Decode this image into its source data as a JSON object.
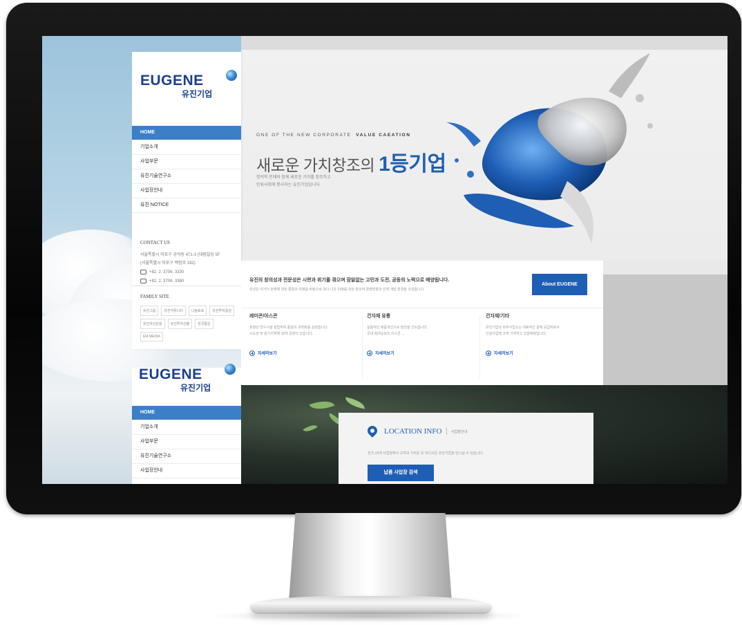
{
  "sidebar": {
    "logo_en": "EUGENE",
    "logo_ko": "유진기업",
    "nav": [
      {
        "label": "HOME",
        "active": true
      },
      {
        "label": "기업소개",
        "active": false
      },
      {
        "label": "사업부문",
        "active": false
      },
      {
        "label": "유진기술연구소",
        "active": false
      },
      {
        "label": "사업장안내",
        "active": false
      },
      {
        "label": "유진 NOTICE",
        "active": false
      }
    ],
    "contact": {
      "title": "CONTACT US",
      "address1": "서울특별시 마포구 공덕동 471-3 (대림빌딩 5F",
      "address2": "(서울특별시 마포구 백범로 192)",
      "tel": "+82. 2. 3706. 3330",
      "fax": "+82. 2. 3706. 3380"
    },
    "family": {
      "title": "FAMILY SITE",
      "links": [
        "유진그룹",
        "유진커뮤니티",
        "나눔토토",
        "유진투자증권",
        "유진자산운용",
        "유진투자선물",
        "한국통운",
        "EM MEDIA"
      ]
    }
  },
  "hero": {
    "eyebrow_plain": "ONE OF THE NEW CORPORATE",
    "eyebrow_bold": "VALUE CAEATION",
    "title_plain": "새로운 가치창조의",
    "title_big": "1등기업",
    "desc_line1": "창의적 인재와 함께 새로운 가치를 창조하고",
    "desc_line2": "인류사회에 봉사하는 유진기업입니다."
  },
  "panel": {
    "headline": "유진의 창의성과 전문성은 시련과 위기를 겪으며 잠잃없는 고민과 도전, 공동의 노력으로 배양됩니다.",
    "subline": "유진은 지거의 현재에 대한 통찰과 미래를 바탕으로 보다 나은 미래를 위한 창조적 경영방향과 인재 개발 환경을 조성합니다.",
    "about_button": "About EUGENE",
    "biz": [
      {
        "title": "레미콘/아스콘",
        "desc1": "최첨단 연구시설 설립하여 품질의 과학화를 실현합니다.",
        "desc2": "시도권 및 광기지역에 18개 공장이 있습니다.",
        "more": "자세히보기"
      },
      {
        "title": "건자재 유통",
        "desc1": "실용적인 제품개선으로 발전을 선도합니다.",
        "desc2": "국내 최대규모의 이스콘 ...",
        "more": "자세히보기"
      },
      {
        "title": "건자재/기타",
        "desc1": "유진기업의 외주사업소는 대표적인 골재 공급처로서",
        "desc2": "건설사업에 크게 기여하고 있을예정입니다.",
        "more": "자세히보기"
      }
    ]
  },
  "location": {
    "title": "LOCATION INFO",
    "subtitle": "사업장안내",
    "desc": "전국 23개 사업장에서 고객과 가까운 유 어디서든 유진기업을 만나실 수 있습니다.",
    "button": "납품 사업장 검색"
  },
  "sidebar2": {
    "logo_en": "EUGENE",
    "logo_ko": "유진기업",
    "nav": [
      {
        "label": "HOME",
        "active": true
      },
      {
        "label": "기업소개",
        "active": false
      },
      {
        "label": "사업부문",
        "active": false
      },
      {
        "label": "유진기술연구소",
        "active": false
      },
      {
        "label": "사업장안내",
        "active": false
      }
    ]
  },
  "colors": {
    "brand_blue": "#1e5eb5",
    "nav_active": "#3b7fc7"
  }
}
